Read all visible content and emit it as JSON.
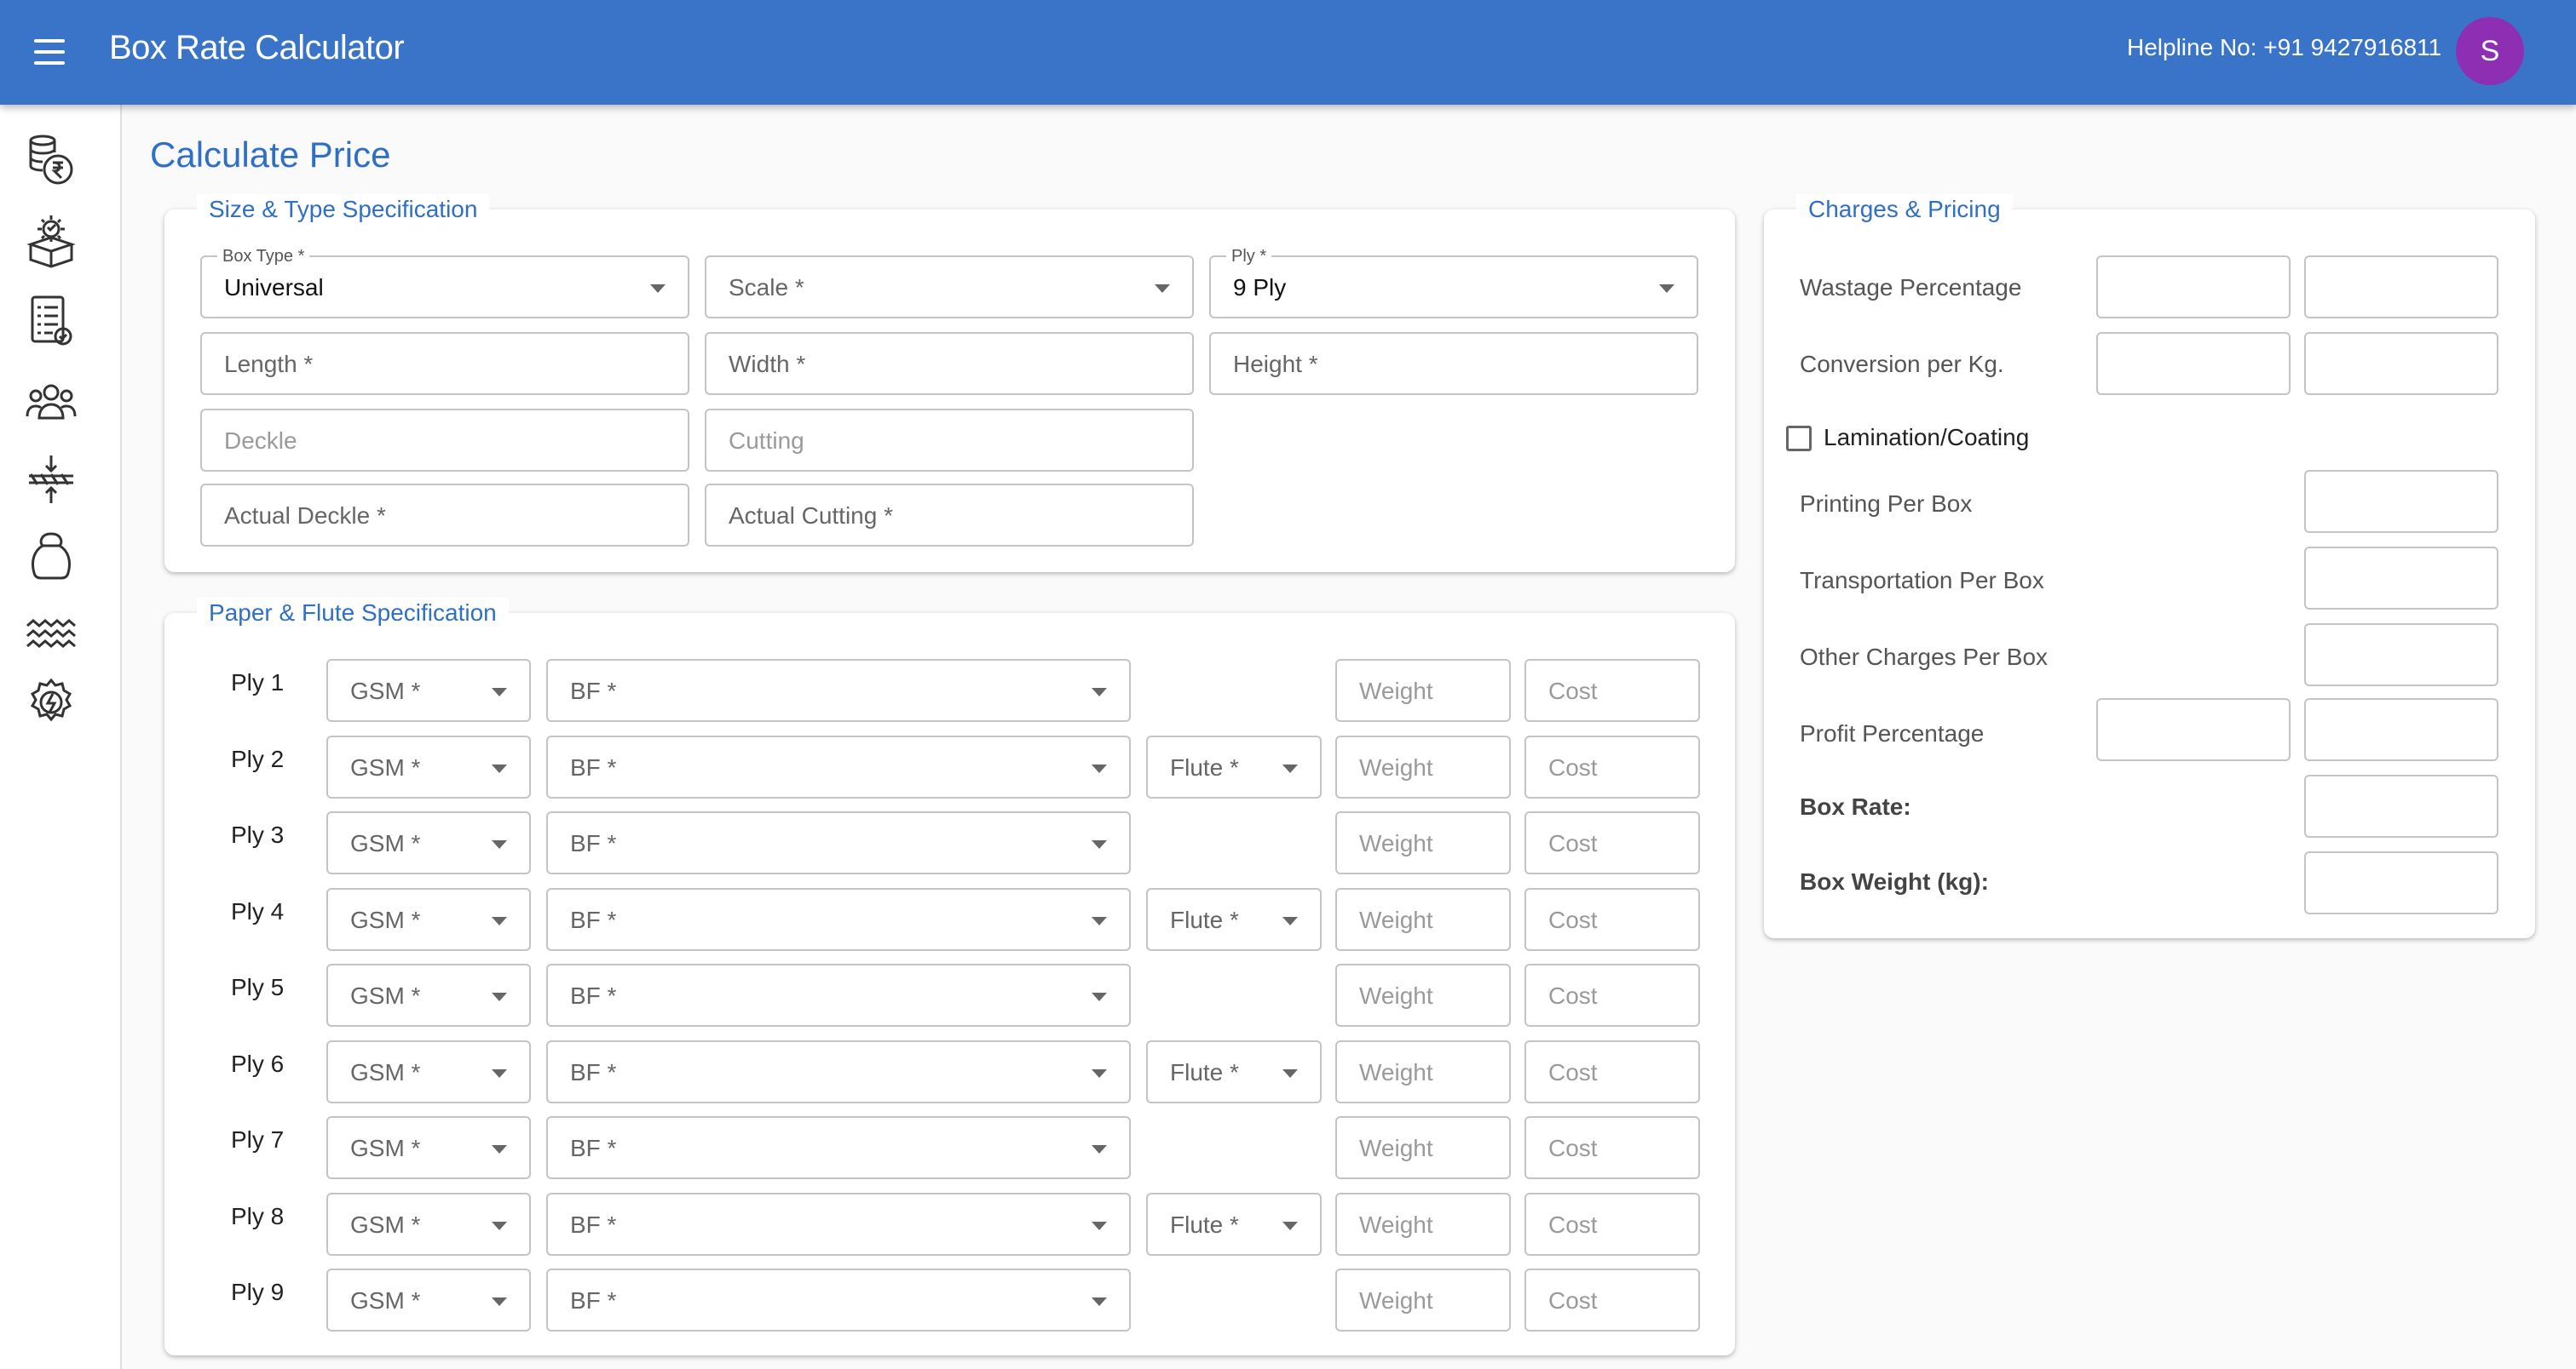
{
  "app": {
    "title": "Box Rate Calculator",
    "helpline": "Helpline No: +91 9427916811",
    "avatar_initial": "S"
  },
  "sidebar": {
    "icons": [
      "coins-rupee-icon",
      "box-settings-icon",
      "checklist-document-icon",
      "users-group-icon",
      "compress-icon",
      "kettlebell-icon",
      "waves-icon",
      "gear-bolt-icon"
    ]
  },
  "page_title": "Calculate Price",
  "size_type": {
    "legend": "Size & Type Specification",
    "box_type": {
      "label": "Box Type *",
      "value": "Universal"
    },
    "scale": {
      "placeholder": "Scale *"
    },
    "ply": {
      "label": "Ply *",
      "value": "9 Ply"
    },
    "length": "Length *",
    "width": "Width *",
    "height": "Height *",
    "deckle": "Deckle",
    "cutting": "Cutting",
    "actual_deckle": "Actual Deckle *",
    "actual_cutting": "Actual Cutting *"
  },
  "paper_flute": {
    "legend": "Paper & Flute Specification",
    "gsm": "GSM *",
    "bf": "BF *",
    "flute": "Flute *",
    "weight": "Weight",
    "cost": "Cost",
    "plies": [
      {
        "label": "Ply 1",
        "flute": false
      },
      {
        "label": "Ply 2",
        "flute": true
      },
      {
        "label": "Ply 3",
        "flute": false
      },
      {
        "label": "Ply 4",
        "flute": true
      },
      {
        "label": "Ply 5",
        "flute": false
      },
      {
        "label": "Ply 6",
        "flute": true
      },
      {
        "label": "Ply 7",
        "flute": false
      },
      {
        "label": "Ply 8",
        "flute": true
      },
      {
        "label": "Ply 9",
        "flute": false
      }
    ]
  },
  "charges": {
    "legend": "Charges & Pricing",
    "wastage": "Wastage Percentage",
    "conversion": "Conversion per Kg.",
    "lamination": "Lamination/Coating",
    "printing": "Printing Per Box",
    "transport": "Transportation Per Box",
    "other": "Other Charges Per Box",
    "profit": "Profit Percentage",
    "box_rate": "Box Rate:",
    "box_weight": "Box Weight (kg):"
  },
  "colors": {
    "primary": "#3a74c9",
    "accent_text": "#2f6fc4",
    "avatar": "#8e2fb3"
  }
}
